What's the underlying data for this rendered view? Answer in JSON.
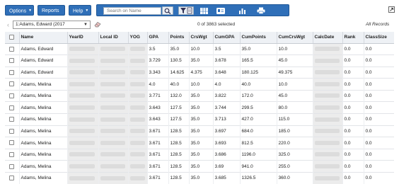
{
  "toolbar": {
    "options_label": "Options",
    "reports_label": "Reports",
    "help_label": "Help",
    "search_placeholder": "Search on Name"
  },
  "nav": {
    "current_record": "1:Adams, Edward (2017",
    "selected_text": "0 of 3863 selected",
    "all_records": "All Records"
  },
  "table": {
    "headers": {
      "name": "Name",
      "year_id": "YearID",
      "local_id": "Local ID",
      "yog": "YOG",
      "gpa": "GPA",
      "points": "Points",
      "crswgt": "CrsWgt",
      "cumgpa": "CumGPA",
      "cumpoints": "CumPoints",
      "cumcrswgt": "CumCrsWgt",
      "calcdate": "CalcDate",
      "rank": "Rank",
      "classsize": "ClassSize"
    },
    "rows": [
      {
        "name": "Adams, Edward",
        "gpa": "3.5",
        "points": "35.0",
        "crswgt": "10.0",
        "cumgpa": "3.5",
        "cumpoints": "35.0",
        "cumcrswgt": "10.0",
        "rank": "0.0",
        "classsize": "0.0"
      },
      {
        "name": "Adams, Edward",
        "gpa": "3.729",
        "points": "130.5",
        "crswgt": "35.0",
        "cumgpa": "3.678",
        "cumpoints": "165.5",
        "cumcrswgt": "45.0",
        "rank": "0.0",
        "classsize": "0.0"
      },
      {
        "name": "Adams, Edward",
        "gpa": "3.343",
        "points": "14.625",
        "crswgt": "4.375",
        "cumgpa": "3.648",
        "cumpoints": "180.125",
        "cumcrswgt": "49.375",
        "rank": "0.0",
        "classsize": "0.0"
      },
      {
        "name": "Adams, Melina",
        "gpa": "4.0",
        "points": "40.0",
        "crswgt": "10.0",
        "cumgpa": "4.0",
        "cumpoints": "40.0",
        "cumcrswgt": "10.0",
        "rank": "0.0",
        "classsize": "0.0"
      },
      {
        "name": "Adams, Melina",
        "gpa": "3.771",
        "points": "132.0",
        "crswgt": "35.0",
        "cumgpa": "3.822",
        "cumpoints": "172.0",
        "cumcrswgt": "45.0",
        "rank": "0.0",
        "classsize": "0.0"
      },
      {
        "name": "Adams, Melina",
        "gpa": "3.643",
        "points": "127.5",
        "crswgt": "35.0",
        "cumgpa": "3.744",
        "cumpoints": "299.5",
        "cumcrswgt": "80.0",
        "rank": "0.0",
        "classsize": "0.0"
      },
      {
        "name": "Adams, Melina",
        "gpa": "3.643",
        "points": "127.5",
        "crswgt": "35.0",
        "cumgpa": "3.713",
        "cumpoints": "427.0",
        "cumcrswgt": "115.0",
        "rank": "0.0",
        "classsize": "0.0"
      },
      {
        "name": "Adams, Melina",
        "gpa": "3.671",
        "points": "128.5",
        "crswgt": "35.0",
        "cumgpa": "3.697",
        "cumpoints": "684.0",
        "cumcrswgt": "185.0",
        "rank": "0.0",
        "classsize": "0.0"
      },
      {
        "name": "Adams, Melina",
        "gpa": "3.671",
        "points": "128.5",
        "crswgt": "35.0",
        "cumgpa": "3.693",
        "cumpoints": "812.5",
        "cumcrswgt": "220.0",
        "rank": "0.0",
        "classsize": "0.0"
      },
      {
        "name": "Adams, Melina",
        "gpa": "3.671",
        "points": "128.5",
        "crswgt": "35.0",
        "cumgpa": "3.686",
        "cumpoints": "1196.0",
        "cumcrswgt": "325.0",
        "rank": "0.0",
        "classsize": "0.0"
      },
      {
        "name": "Adams, Melina",
        "gpa": "3.671",
        "points": "128.5",
        "crswgt": "35.0",
        "cumgpa": "3.69",
        "cumpoints": "941.0",
        "cumcrswgt": "255.0",
        "rank": "0.0",
        "classsize": "0.0"
      },
      {
        "name": "Adams, Melina",
        "gpa": "3.671",
        "points": "128.5",
        "crswgt": "35.0",
        "cumgpa": "3.685",
        "cumpoints": "1326.5",
        "cumcrswgt": "360.0",
        "rank": "0.0",
        "classsize": "0.0"
      }
    ]
  },
  "colors": {
    "toolbar_blue": "#2f6fb8",
    "header_bg": "#eef1f5"
  }
}
